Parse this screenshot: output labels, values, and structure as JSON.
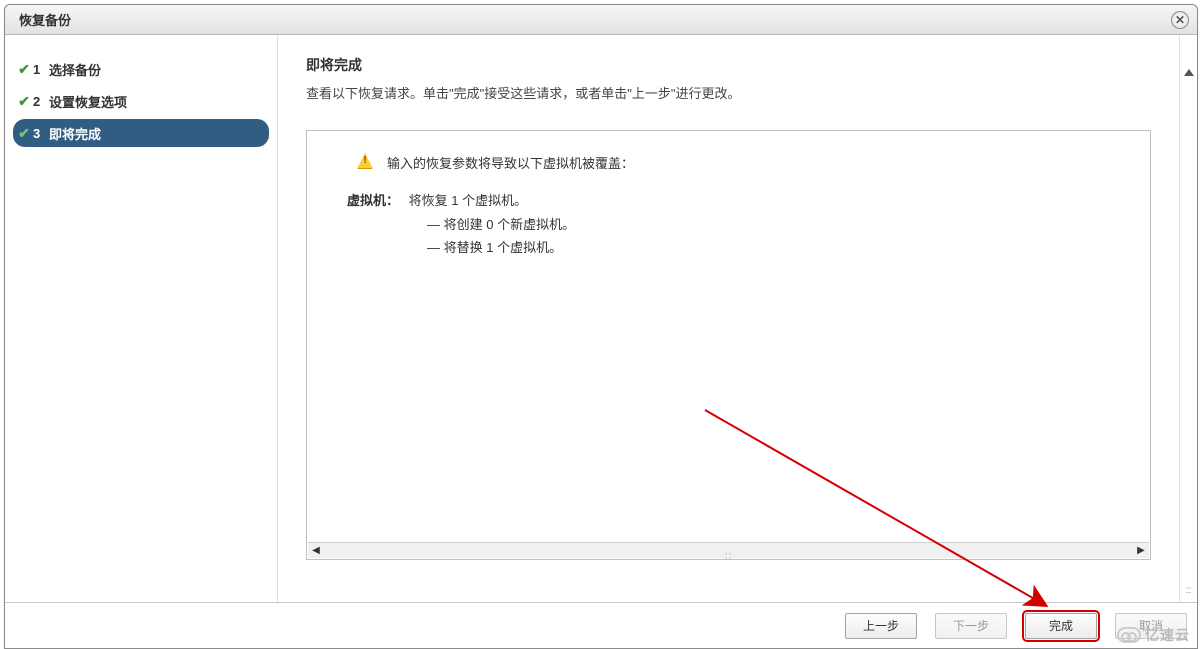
{
  "window": {
    "title": "恢复备份"
  },
  "sidebar": {
    "steps": [
      {
        "num": "1",
        "label": "选择备份"
      },
      {
        "num": "2",
        "label": "设置恢复选项"
      },
      {
        "num": "3",
        "label": "即将完成"
      }
    ]
  },
  "content": {
    "title": "即将完成",
    "subtitle": "查看以下恢复请求。单击\"完成\"接受这些请求，或者单击\"上一步\"进行更改。",
    "warning": "输入的恢复参数将导致以下虚拟机被覆盖：",
    "vm_label": "虚拟机：",
    "vm_summary": "将恢复 1 个虚拟机。",
    "vm_line1": "— 将创建 0 个新虚拟机。",
    "vm_line2": "— 将替换 1 个虚拟机。"
  },
  "footer": {
    "back": "上一步",
    "next": "下一步",
    "finish": "完成",
    "cancel": "取消"
  },
  "watermark": "亿速云"
}
